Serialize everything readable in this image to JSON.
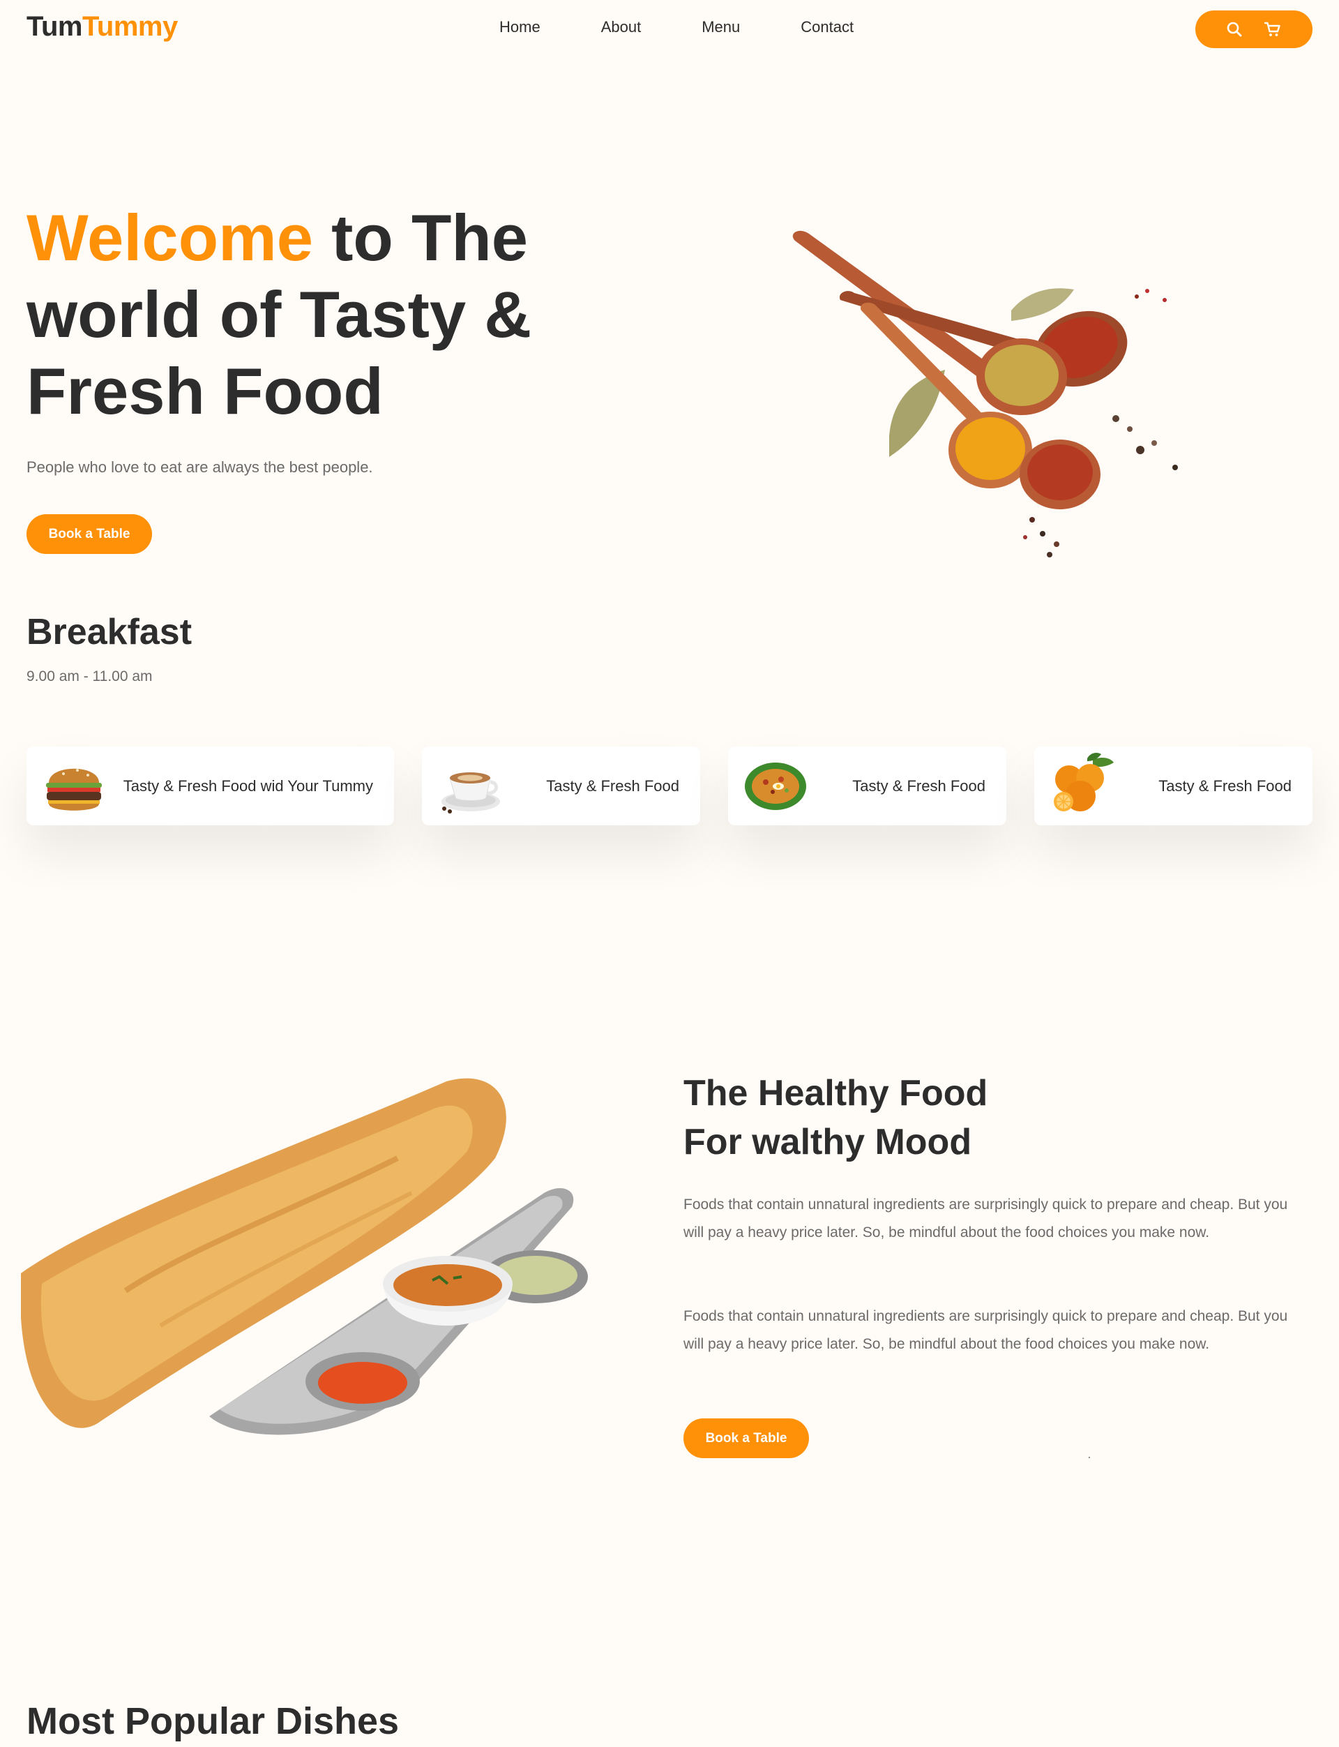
{
  "brand": {
    "part1": "Tum",
    "part2": "Tummy"
  },
  "nav": {
    "links": [
      {
        "label": "Home"
      },
      {
        "label": "About"
      },
      {
        "label": "Menu"
      },
      {
        "label": "Contact"
      }
    ],
    "actions": {
      "search_icon": "search-icon",
      "cart_icon": "cart-icon"
    }
  },
  "hero": {
    "title_accent": "Welcome",
    "title_rest": " to The world of Tasty & Fresh Food",
    "subtitle": "People who love to eat are always the best people.",
    "cta": "Book a Table",
    "image": "spices-on-wooden-spoons"
  },
  "breakfast": {
    "title": "Breakfast",
    "time": "9.00 am - 11.00 am",
    "items": [
      {
        "label": "Tasty & Fresh Food wid Your Tummy",
        "image": "burger"
      },
      {
        "label": "Tasty & Fresh Food",
        "image": "coffee-cup"
      },
      {
        "label": "Tasty & Fresh Food",
        "image": "rice-plate"
      },
      {
        "label": "Tasty & Fresh Food",
        "image": "oranges"
      }
    ]
  },
  "healthy": {
    "title_line1": "The Healthy Food",
    "title_line2": "For walthy Mood",
    "paragraphs": [
      "Foods that contain unnatural ingredients are surprisingly quick to prepare and cheap. But you will pay a heavy price later. So, be mindful about the food choices you make now.",
      "Foods that contain unnatural ingredients are surprisingly quick to prepare and cheap. But you will pay a heavy price later. So, be mindful about the food choices you make now."
    ],
    "cta": "Book a Table",
    "image": "dosa-with-sambar-plate"
  },
  "popular": {
    "title": "Most Popular Dishes"
  },
  "colors": {
    "accent": "#ff9108",
    "text": "#2d2d2d",
    "muted": "#6b6b6b",
    "background": "#fffbf6"
  }
}
